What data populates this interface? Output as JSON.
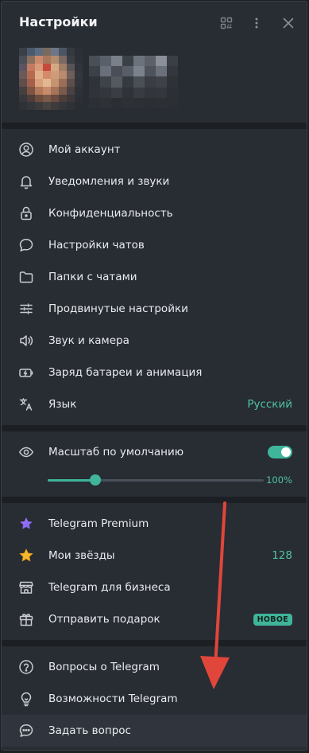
{
  "header": {
    "title": "Настройки"
  },
  "account": [
    {
      "key": "account",
      "label": "Мой аккаунт",
      "icon": "user-circle-icon"
    },
    {
      "key": "notifications",
      "label": "Уведомления и звуки",
      "icon": "bell-icon"
    },
    {
      "key": "privacy",
      "label": "Конфиденциальность",
      "icon": "lock-icon"
    },
    {
      "key": "chats",
      "label": "Настройки чатов",
      "icon": "chat-bubble-icon"
    },
    {
      "key": "folders",
      "label": "Папки с чатами",
      "icon": "folder-icon"
    },
    {
      "key": "advanced",
      "label": "Продвинутые настройки",
      "icon": "sliders-icon"
    },
    {
      "key": "sound",
      "label": "Звук и камера",
      "icon": "speaker-icon"
    },
    {
      "key": "battery",
      "label": "Заряд батареи и анимация",
      "icon": "battery-icon"
    },
    {
      "key": "language",
      "label": "Язык",
      "icon": "translate-icon",
      "value": "Русский"
    }
  ],
  "scale": {
    "label": "Масштаб по умолчанию",
    "icon": "eye-icon",
    "enabled": true,
    "value_label": "100%",
    "level": 0.22
  },
  "premium": [
    {
      "key": "premium",
      "label": "Telegram Premium",
      "icon": "star-purple-icon"
    },
    {
      "key": "stars",
      "label": "Мои звёзды",
      "icon": "star-gold-icon",
      "value": "128"
    },
    {
      "key": "business",
      "label": "Telegram для бизнеса",
      "icon": "shop-icon"
    },
    {
      "key": "gift",
      "label": "Отправить подарок",
      "icon": "gift-icon",
      "badge": "НОВОЕ"
    }
  ],
  "help": [
    {
      "key": "faq",
      "label": "Вопросы о Telegram",
      "icon": "question-circle-icon"
    },
    {
      "key": "features",
      "label": "Возможности Telegram",
      "icon": "lightbulb-icon"
    },
    {
      "key": "ask",
      "label": "Задать вопрос",
      "icon": "chat-dots-icon"
    }
  ],
  "colors": {
    "accent": "#3fb59a",
    "annotation_arrow": "#e0463a"
  }
}
